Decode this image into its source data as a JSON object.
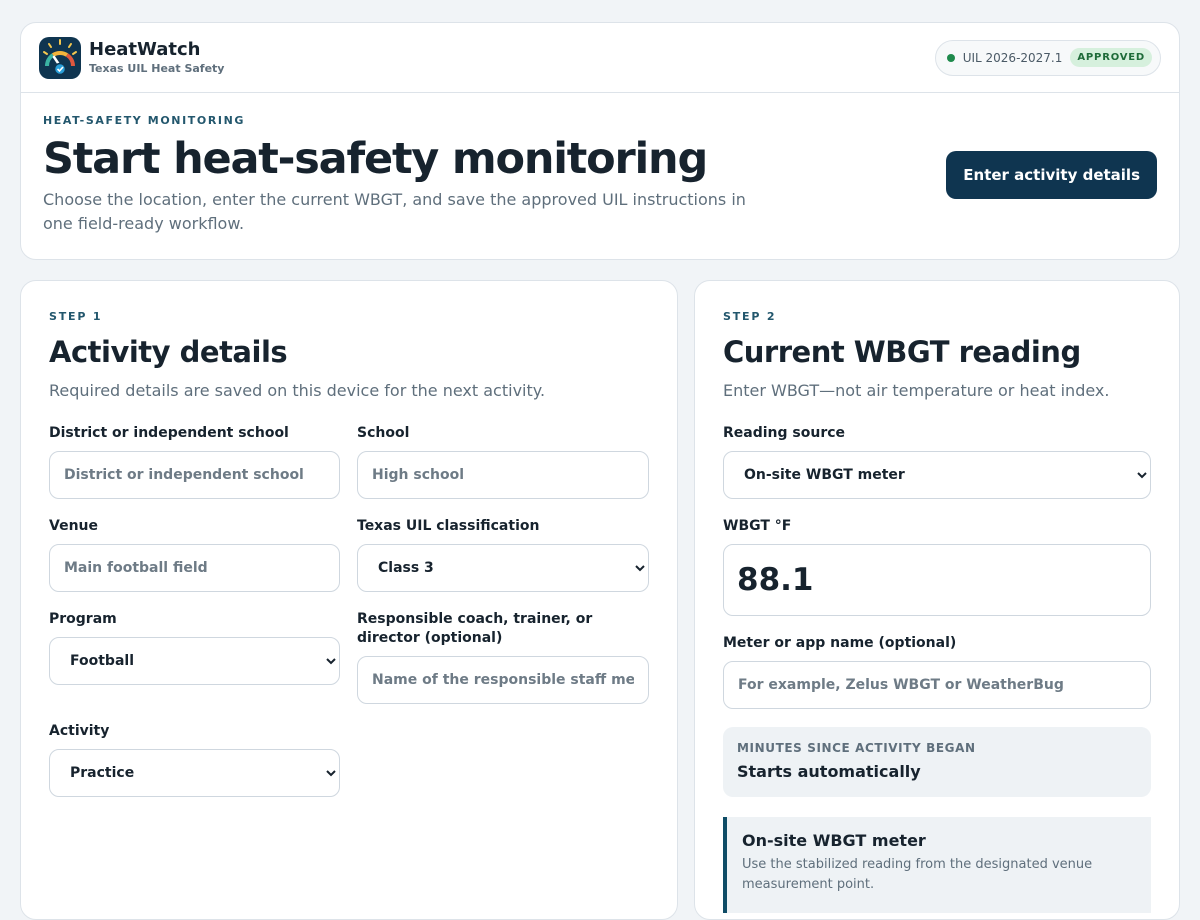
{
  "app": {
    "name": "HeatWatch",
    "subtitle": "Texas UIL Heat Safety",
    "version": "UIL 2026-2027.1",
    "status_badge": "APPROVED",
    "status_color": "#1f8a4c"
  },
  "hero": {
    "eyebrow": "HEAT-SAFETY MONITORING",
    "title": "Start heat-safety monitoring",
    "description": "Choose the location, enter the current WBGT, and save the approved UIL instructions in one field-ready workflow.",
    "cta": "Enter activity details"
  },
  "step1": {
    "step": "STEP 1",
    "title": "Activity details",
    "description": "Required details are saved on this device for the next activity.",
    "district": {
      "label": "District or independent school",
      "placeholder": "District or independent school",
      "value": ""
    },
    "school": {
      "label": "School",
      "placeholder": "High school",
      "value": ""
    },
    "venue": {
      "label": "Venue",
      "placeholder": "Main football field",
      "value": ""
    },
    "classification": {
      "label": "Texas UIL classification",
      "selected": "Class 3"
    },
    "program": {
      "label": "Program",
      "selected": "Football"
    },
    "staff": {
      "label": "Responsible coach, trainer, or director (optional)",
      "placeholder": "Name of the responsible staff member",
      "value": ""
    },
    "activity": {
      "label": "Activity",
      "selected": "Practice"
    }
  },
  "step2": {
    "step": "STEP 2",
    "title": "Current WBGT reading",
    "description": "Enter WBGT—not air temperature or heat index.",
    "source": {
      "label": "Reading source",
      "selected": "On-site WBGT meter"
    },
    "wbgt": {
      "label": "WBGT °F",
      "value": "88.1"
    },
    "meter": {
      "label": "Meter or app name (optional)",
      "placeholder": "For example, Zelus WBGT or WeatherBug",
      "value": ""
    },
    "minutes": {
      "label": "MINUTES SINCE ACTIVITY BEGAN",
      "value": "Starts automatically"
    },
    "info": {
      "title": "On-site WBGT meter",
      "text": "Use the stabilized reading from the designated venue measurement point."
    }
  }
}
